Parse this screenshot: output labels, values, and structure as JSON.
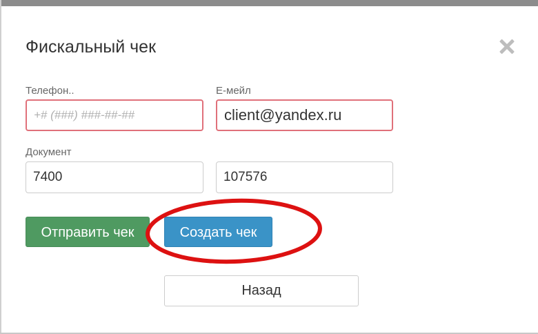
{
  "dialog": {
    "title": "Фискальный чек",
    "close_icon": "close-icon"
  },
  "form": {
    "phone": {
      "label": "Телефон..",
      "placeholder": "+# (###) ###-##-##",
      "value": ""
    },
    "email": {
      "label": "Е-мейл",
      "value": "client@yandex.ru"
    },
    "document": {
      "label": "Документ",
      "value_1": "7400",
      "value_2": "107576"
    }
  },
  "buttons": {
    "send": "Отправить чек",
    "create": "Создать чек",
    "back": "Назад"
  },
  "colors": {
    "send_button": "#4f9a61",
    "create_button": "#3a93c7",
    "error_border": "#e0707a",
    "highlight_ellipse": "#dd1111"
  }
}
